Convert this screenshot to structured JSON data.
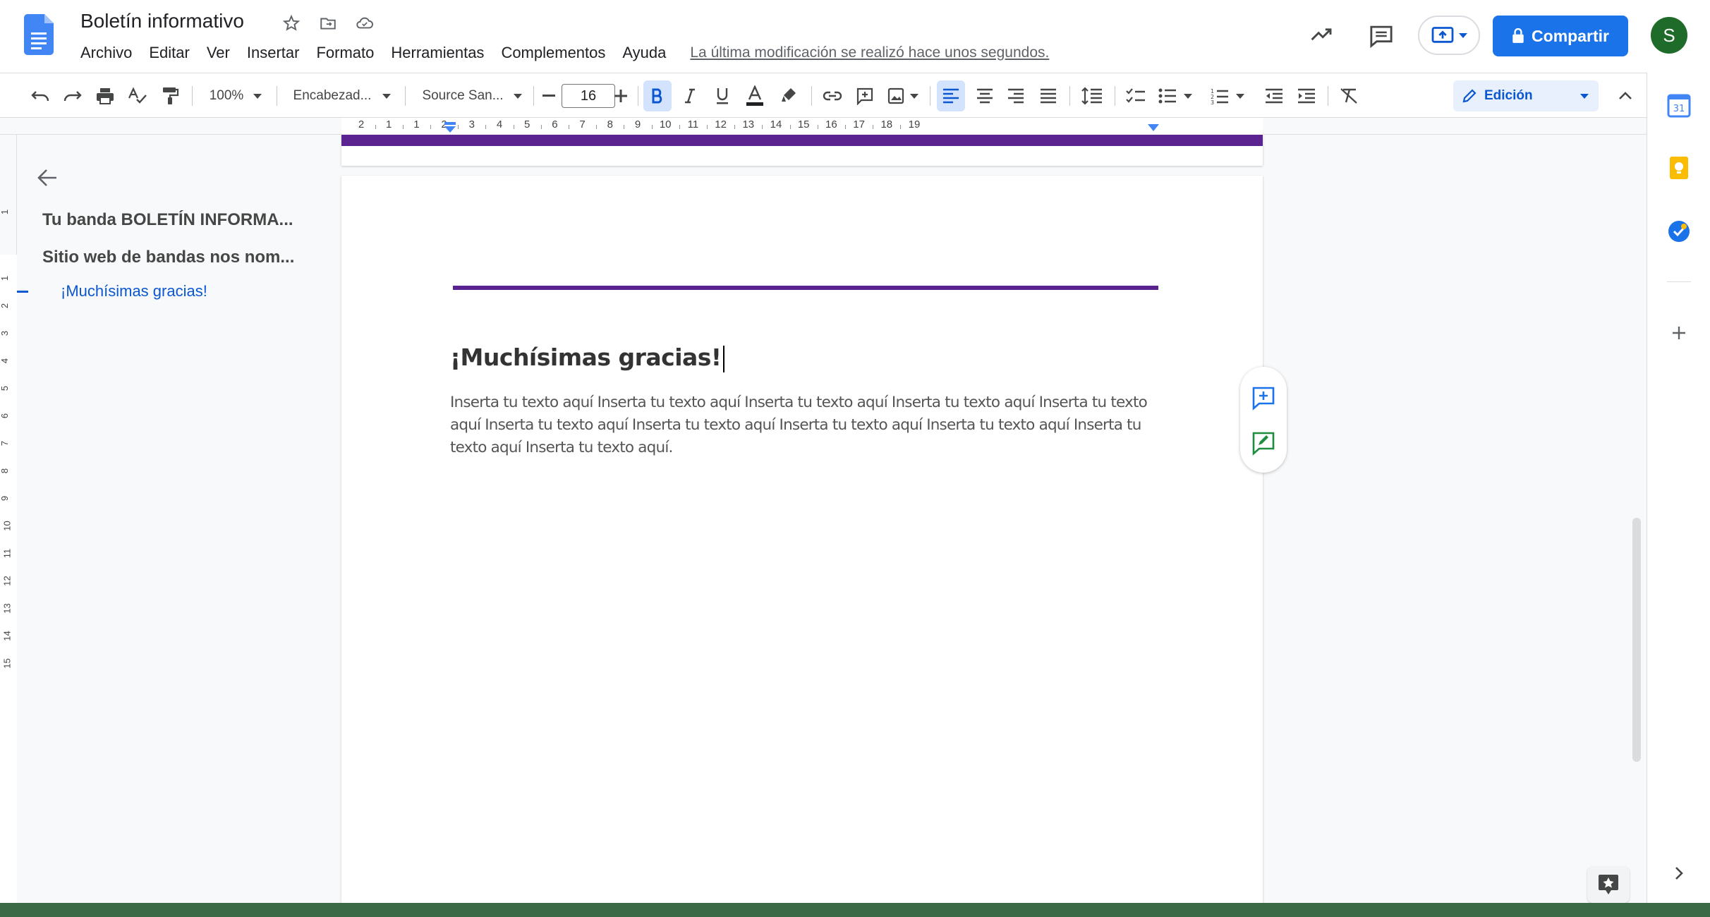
{
  "document": {
    "title": "Boletín informativo",
    "last_edit": "La última modificación se realizó hace unos segundos."
  },
  "menu": [
    "Archivo",
    "Editar",
    "Ver",
    "Insertar",
    "Formato",
    "Herramientas",
    "Complementos",
    "Ayuda"
  ],
  "header_actions": {
    "share_label": "Compartir",
    "avatar_initial": "S"
  },
  "toolbar": {
    "zoom": "100%",
    "style": "Encabezad...",
    "font": "Source San...",
    "font_size": "16",
    "mode_label": "Edición"
  },
  "ruler": {
    "h_labels": [
      "2",
      "1",
      "1",
      "2",
      "3",
      "4",
      "5",
      "6",
      "7",
      "8",
      "9",
      "10",
      "11",
      "12",
      "13",
      "14",
      "15",
      "16",
      "17",
      "18",
      "19"
    ],
    "v_labels": [
      "1",
      "1",
      "2",
      "3",
      "4",
      "5",
      "6",
      "7",
      "8",
      "9",
      "10",
      "11",
      "12",
      "13",
      "14",
      "15"
    ]
  },
  "outline": {
    "items": [
      "Tu banda BOLETÍN INFORMA...",
      "Sitio web de bandas nos nom..."
    ],
    "sub_item": "¡Muchísimas gracias!"
  },
  "page": {
    "heading": "¡Muchísimas gracias!",
    "body": "Inserta tu texto aquí Inserta tu texto aquí Inserta tu texto aquí Inserta tu texto aquí Inserta tu texto aquí Inserta tu texto aquí Inserta tu texto aquí Inserta tu texto aquí Inserta tu texto aquí Inserta tu texto aquí Inserta tu texto aquí."
  },
  "colors": {
    "accent_purple": "#5b2390",
    "share_blue": "#1a73e8",
    "avatar_green": "#1e6b2a"
  }
}
